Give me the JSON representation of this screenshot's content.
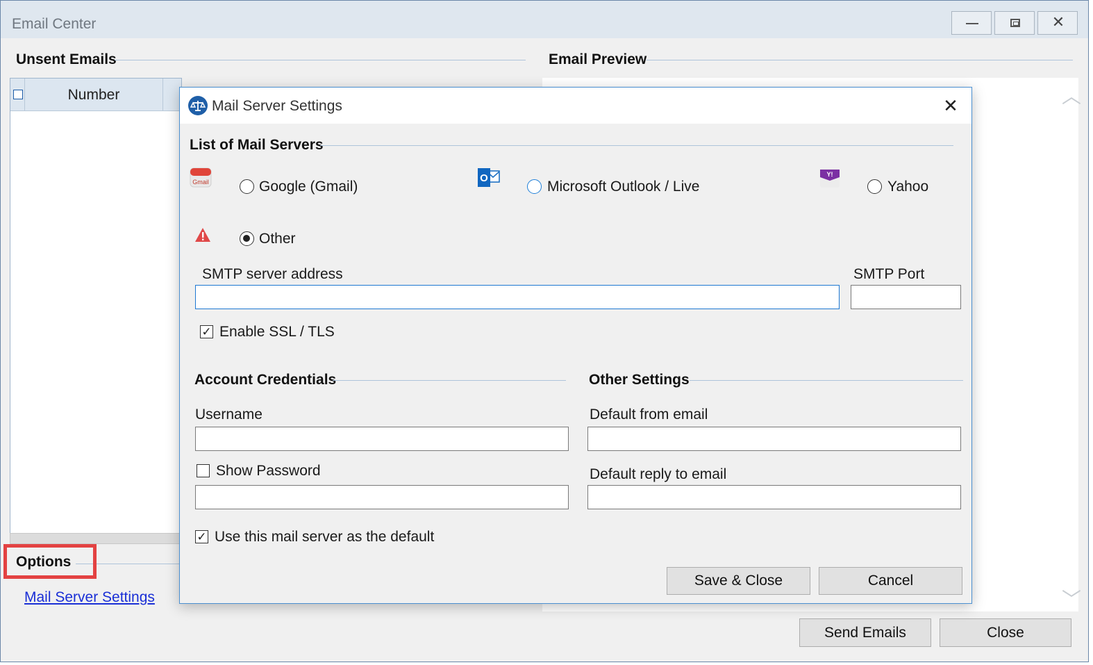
{
  "window": {
    "title": "Email Center"
  },
  "unsent": {
    "title": "Unsent Emails",
    "columns": [
      "Number"
    ]
  },
  "preview": {
    "title": "Email Preview"
  },
  "options": {
    "title": "Options",
    "link": "Mail Server Settings"
  },
  "footer": {
    "send_label": "Send Emails",
    "close_label": "Close"
  },
  "dialog": {
    "title": "Mail Server Settings",
    "servers_title": "List of Mail Servers",
    "servers": [
      {
        "label": "Google (Gmail)",
        "icon": "gmail-icon",
        "checked": false
      },
      {
        "label": "Microsoft Outlook / Live",
        "icon": "outlook-icon",
        "checked": false
      },
      {
        "label": "Yahoo",
        "icon": "yahoo-icon",
        "checked": false
      },
      {
        "label": "Other",
        "icon": "warning-icon",
        "checked": true
      }
    ],
    "smtp_label": "SMTP server address",
    "smtp_value": "",
    "port_label": "SMTP Port",
    "port_value": "",
    "ssl_label": "Enable SSL / TLS",
    "ssl_checked": true,
    "credentials_title": "Account Credentials",
    "username_label": "Username",
    "username_value": "",
    "show_password_label": "Show Password",
    "show_password_checked": false,
    "password_value": "",
    "other_title": "Other Settings",
    "from_label": "Default from email",
    "from_value": "",
    "reply_label": "Default reply to email",
    "reply_value": "",
    "default_label": "Use this mail server as the default",
    "default_checked": true,
    "save_label": "Save & Close",
    "cancel_label": "Cancel"
  },
  "colors": {
    "accent": "#1e78d2",
    "highlight": "#e34242",
    "link": "#1a2fd6"
  }
}
